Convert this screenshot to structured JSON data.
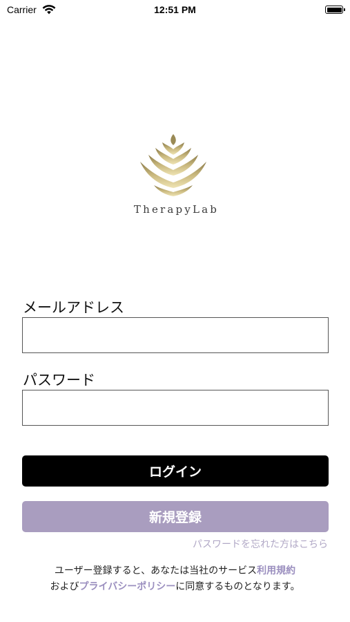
{
  "status_bar": {
    "carrier": "Carrier",
    "time": "12:51 PM"
  },
  "brand": {
    "name": "TherapyLab",
    "logo_icon": "gold-leaf-logo-icon",
    "logo_color": "#c8b67a"
  },
  "form": {
    "email_label": "メールアドレス",
    "email_value": "",
    "password_label": "パスワード",
    "password_value": ""
  },
  "buttons": {
    "login_label": "ログイン",
    "register_label": "新規登録"
  },
  "forgot_password_link": "パスワードを忘れた方はこちら",
  "terms": {
    "prefix": "ユーザー登録すると、あなたは当社のサービス",
    "terms_link": "利用規約",
    "connector": "および",
    "privacy_link": "プライバシーポリシー",
    "suffix": "に同意するものとなります。"
  },
  "colors": {
    "login_bg": "#000000",
    "register_bg": "#a99dbf",
    "link": "#9b8fbf"
  }
}
